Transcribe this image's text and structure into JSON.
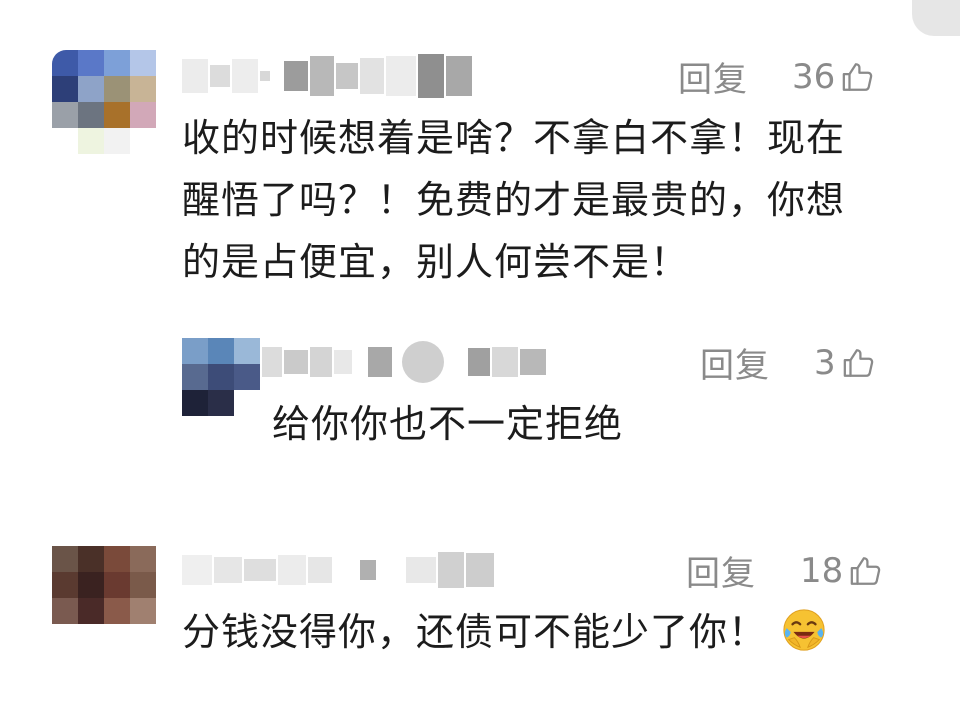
{
  "comments": [
    {
      "reply_label": "回复",
      "like_count": "36",
      "lines": [
        "收的时候想着是啥？不拿白不拿！现在",
        "醒悟了吗？！免费的才是最贵的，你想",
        "的是占便宜，别人何尝不是！"
      ]
    },
    {
      "reply_label": "回复",
      "like_count": "3",
      "lines": [
        "给你你也不一定拒绝"
      ]
    },
    {
      "reply_label": "回复",
      "like_count": "18",
      "lines": [
        "分钱没得你，还债可不能少了你！"
      ],
      "emoji": "crying-laughing-face-icon"
    }
  ]
}
